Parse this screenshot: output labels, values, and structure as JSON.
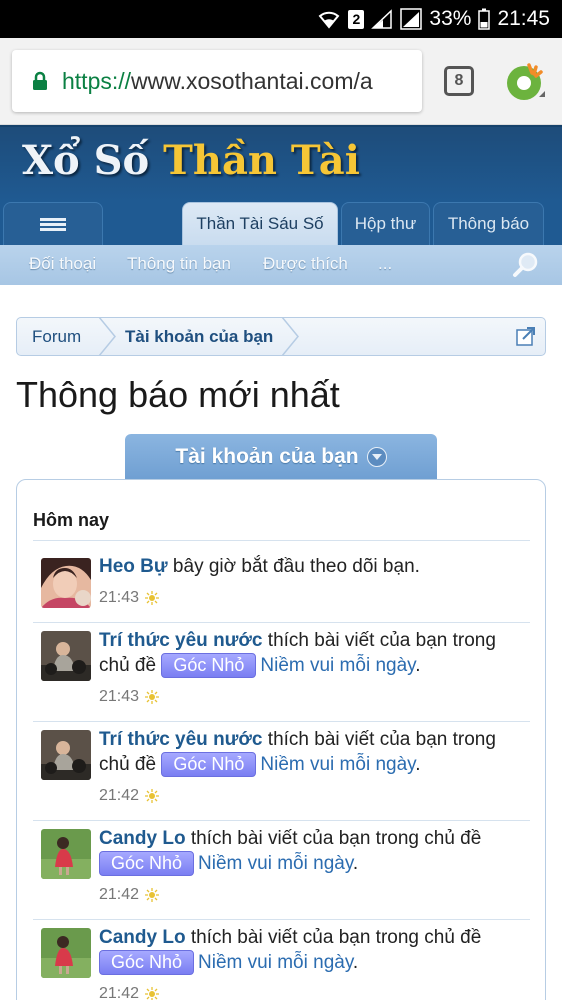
{
  "status_bar": {
    "sim_badge": "2",
    "battery": "33%",
    "clock": "21:45"
  },
  "browser": {
    "url_scheme": "https://",
    "url_rest": "www.xosothantai.com/a",
    "tab_count": "8"
  },
  "site": {
    "logo_word1": "Xổ Số ",
    "logo_word2": "Thần Tài"
  },
  "nav": {
    "tabs": [
      {
        "label": "Thần Tài Sáu Số"
      },
      {
        "label": "Hộp thư"
      },
      {
        "label": "Thông báo"
      }
    ],
    "sub_items": [
      {
        "label": "Đối thoại"
      },
      {
        "label": "Thông tin bạn"
      },
      {
        "label": "Được thích"
      },
      {
        "label": "..."
      }
    ]
  },
  "breadcrumb": {
    "items": [
      {
        "label": "Forum"
      },
      {
        "label": "Tài khoản của bạn"
      }
    ]
  },
  "page": {
    "title": "Thông báo mới nhất",
    "account_tab": "Tài khoản của bạn",
    "day_header": "Hôm nay"
  },
  "notifications": [
    {
      "user": "Heo Bự",
      "text": " bây giờ bắt đầu theo dõi bạn.",
      "prefix": "",
      "thread": "",
      "time": "21:43"
    },
    {
      "user": "Trí thức yêu nước",
      "text": " thích bài viết của bạn trong chủ đề ",
      "prefix": "Góc Nhỏ",
      "thread": "Niềm vui mỗi ngày",
      "time": "21:43"
    },
    {
      "user": "Trí thức yêu nước",
      "text": " thích bài viết của bạn trong chủ đề ",
      "prefix": "Góc Nhỏ",
      "thread": "Niềm vui mỗi ngày",
      "time": "21:42"
    },
    {
      "user": "Candy Lo",
      "text": " thích bài viết của bạn trong chủ đề ",
      "prefix": "Góc Nhỏ",
      "thread": "Niềm vui mỗi ngày",
      "time": "21:42"
    },
    {
      "user": "Candy Lo",
      "text": " thích bài viết của bạn trong chủ đề ",
      "prefix": "Góc Nhỏ",
      "thread": "Niềm vui mỗi ngày",
      "time": "21:42"
    }
  ],
  "colors": {
    "header_blue": "#1f5a92",
    "link_blue": "#1f5a8f",
    "prefix_purple": "#7a7ef2",
    "logo_gold": "#f6c636"
  },
  "icons": {
    "lock": "lock-icon",
    "menu": "hamburger-icon",
    "search": "search-icon",
    "popout": "popout-icon",
    "dropdown": "chevron-down-icon",
    "time_marker": "sun-icon"
  }
}
